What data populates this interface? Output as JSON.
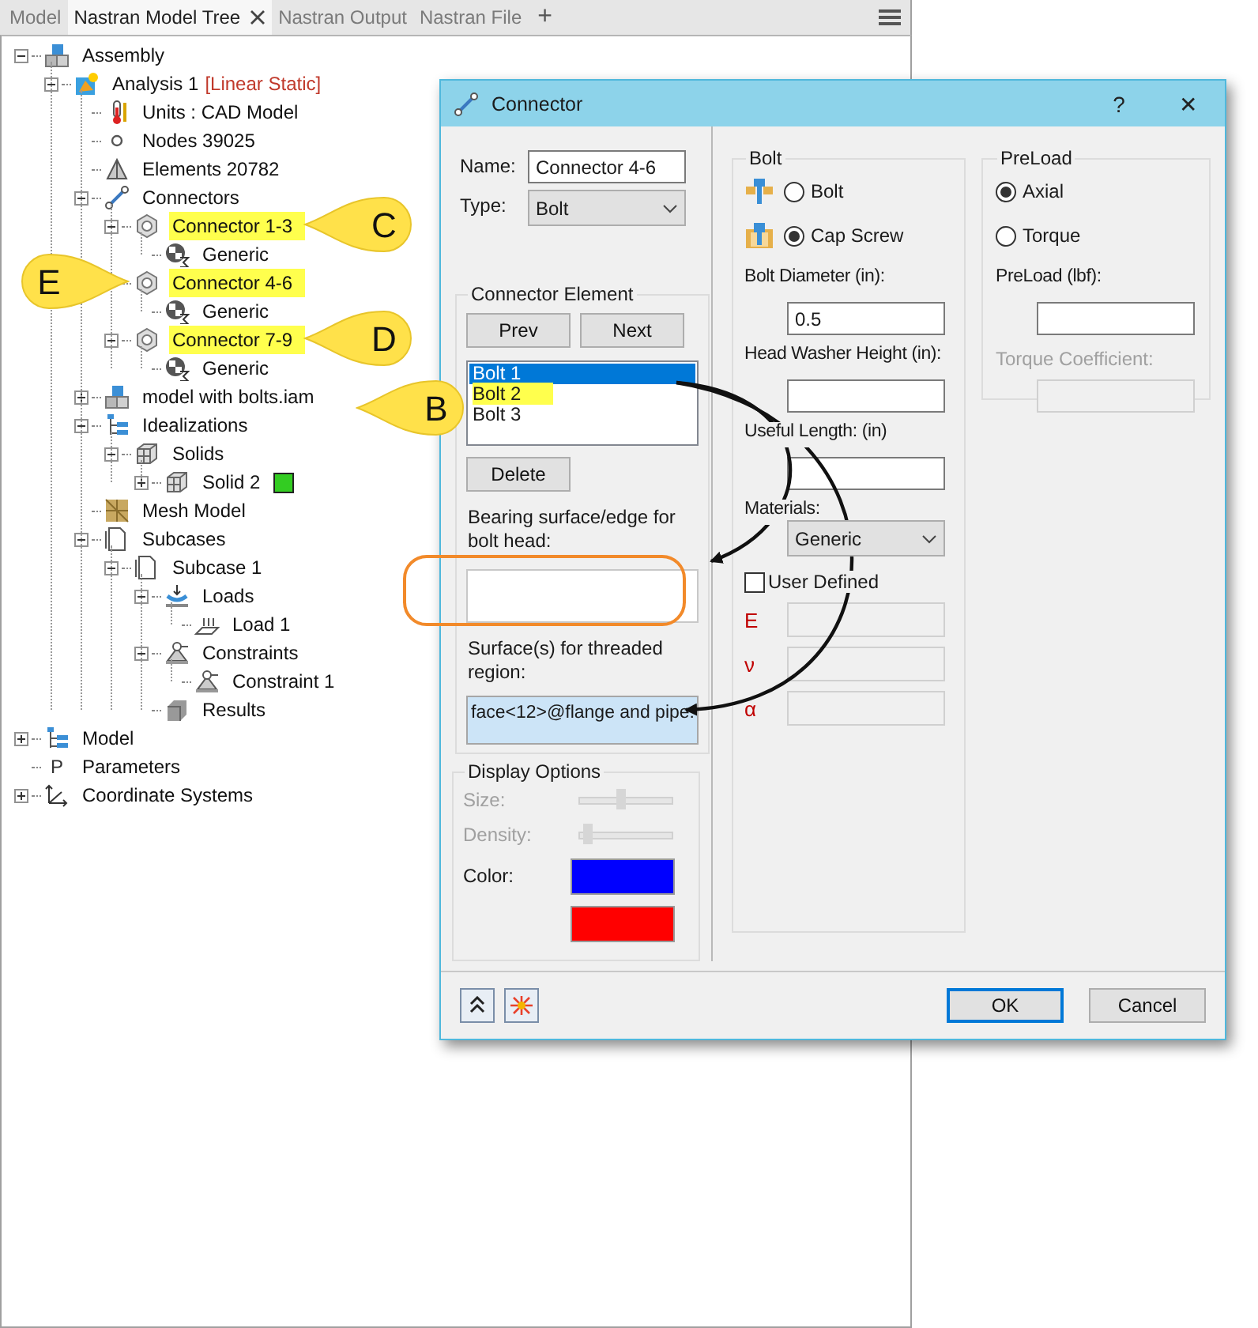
{
  "tabs": [
    {
      "label": "Model",
      "selected": false,
      "closable": false
    },
    {
      "label": "Nastran Model Tree",
      "selected": true,
      "closable": true
    },
    {
      "label": "Nastran Output",
      "selected": false,
      "closable": false
    },
    {
      "label": "Nastran File",
      "selected": false,
      "closable": false
    }
  ],
  "new_tab": "+",
  "tree": [
    {
      "label": "Assembly",
      "kind": "assembly",
      "expanded": true,
      "highlighted": false,
      "children": [
        {
          "label": "Analysis 1",
          "tag": "[Linear Static]",
          "kind": "analysis",
          "expanded": true,
          "highlighted": false,
          "children": [
            {
              "label": "Units : CAD Model",
              "kind": "thermometer",
              "highlighted": false
            },
            {
              "label": "Nodes 39025",
              "kind": "node",
              "highlighted": false
            },
            {
              "label": "Elements 20782",
              "kind": "element",
              "highlighted": false
            },
            {
              "label": "Connectors",
              "kind": "connector",
              "expanded": true,
              "highlighted": false,
              "children": [
                {
                  "label": "Connector 1-3",
                  "kind": "nut",
                  "expanded": true,
                  "highlighted": true,
                  "children": [
                    {
                      "label": "Generic",
                      "kind": "material",
                      "highlighted": false
                    }
                  ]
                },
                {
                  "label": "Connector 4-6",
                  "kind": "nut",
                  "highlighted": true,
                  "children": [
                    {
                      "label": "Generic",
                      "kind": "material",
                      "highlighted": false
                    }
                  ]
                },
                {
                  "label": "Connector 7-9",
                  "kind": "nut",
                  "expanded": true,
                  "highlighted": true,
                  "children": [
                    {
                      "label": "Generic",
                      "kind": "material",
                      "highlighted": false
                    }
                  ]
                }
              ]
            },
            {
              "label": "model with bolts.iam",
              "kind": "assembly",
              "expanded": false,
              "highlighted": false
            },
            {
              "label": "Idealizations",
              "kind": "list",
              "expanded": true,
              "highlighted": false,
              "children": [
                {
                  "label": "Solids",
                  "kind": "solid",
                  "expanded": true,
                  "highlighted": false,
                  "children": [
                    {
                      "label": "Solid 2",
                      "kind": "solid",
                      "expanded": false,
                      "highlighted": false,
                      "color": "#33cc22"
                    }
                  ]
                }
              ]
            },
            {
              "label": "Mesh Model",
              "kind": "mesh",
              "highlighted": false
            },
            {
              "label": "Subcases",
              "kind": "doc",
              "expanded": true,
              "highlighted": false,
              "children": [
                {
                  "label": "Subcase 1",
                  "kind": "doc",
                  "expanded": true,
                  "highlighted": false,
                  "children": [
                    {
                      "label": "Loads",
                      "kind": "loads",
                      "expanded": true,
                      "highlighted": false,
                      "children": [
                        {
                          "label": "Load 1",
                          "kind": "load",
                          "highlighted": false
                        }
                      ]
                    },
                    {
                      "label": "Constraints",
                      "kind": "constraint",
                      "expanded": true,
                      "highlighted": false,
                      "children": [
                        {
                          "label": "Constraint 1",
                          "kind": "constraint",
                          "highlighted": false
                        }
                      ]
                    },
                    {
                      "label": "Results",
                      "kind": "results",
                      "highlighted": false
                    }
                  ]
                }
              ]
            }
          ]
        }
      ]
    },
    {
      "label": "Model",
      "kind": "list",
      "expanded": false,
      "highlighted": false
    },
    {
      "label": "Parameters",
      "glyph": "P",
      "highlighted": false
    },
    {
      "label": "Coordinate Systems",
      "kind": "axes",
      "expanded": false,
      "highlighted": false
    }
  ],
  "callouts": [
    {
      "letter": "C"
    },
    {
      "letter": "E"
    },
    {
      "letter": "D"
    },
    {
      "letter": "B"
    }
  ],
  "dialog": {
    "title": "Connector",
    "help": "?",
    "close": "✕",
    "name_label": "Name:",
    "name_value": "Connector 4-6",
    "type_label": "Type:",
    "type_value": "Bolt",
    "element_group": {
      "title": "Connector Element",
      "prev": "Prev",
      "next": "Next",
      "list": [
        {
          "label": "Bolt 1",
          "selected": true,
          "highlighted": false
        },
        {
          "label": "Bolt 2",
          "selected": false,
          "highlighted": true
        },
        {
          "label": "Bolt 3",
          "selected": false,
          "highlighted": false
        }
      ],
      "delete": "Delete",
      "bearing_label": "Bearing surface/edge for bolt head:",
      "thread_label": "Surface(s) for threaded region:",
      "thread_value": "face<12>@flange and pipe:"
    },
    "display": {
      "title": "Display Options",
      "sliders": [
        {
          "label": "Size:",
          "level": 0.45,
          "disabled": true
        },
        {
          "label": "Density:",
          "level": 0.05,
          "disabled": true
        }
      ],
      "color_label": "Color:",
      "swatches": [
        {
          "color": "#0000ff"
        },
        {
          "color": "#ff0000"
        }
      ]
    },
    "bolt": {
      "title": "Bolt",
      "types": [
        {
          "label": "Bolt",
          "kind": "bolt",
          "selected": false
        },
        {
          "label": "Cap Screw",
          "kind": "capscrew",
          "selected": true
        }
      ],
      "fields": [
        {
          "label": "Bolt Diameter (in):",
          "value": "0.5"
        },
        {
          "label": "Head Washer Height (in):"
        },
        {
          "label": "Useful Length: (in)"
        }
      ],
      "materials_label": "Materials:",
      "materials_value": "Generic",
      "user_defined": {
        "label": "User Defined",
        "checked": false
      },
      "properties": [
        {
          "symbol": "E",
          "disabled": true
        },
        {
          "symbol": "ν",
          "disabled": true
        },
        {
          "symbol": "α",
          "disabled": true
        }
      ]
    },
    "preload": {
      "title": "PreLoad",
      "modes": [
        {
          "label": "Axial",
          "selected": true
        },
        {
          "label": "Torque",
          "selected": false
        }
      ],
      "value_label": "PreLoad (lbf):",
      "coef_label": "Torque Coefficient:",
      "coef_disabled": true
    },
    "ok": "OK",
    "cancel": "Cancel"
  }
}
